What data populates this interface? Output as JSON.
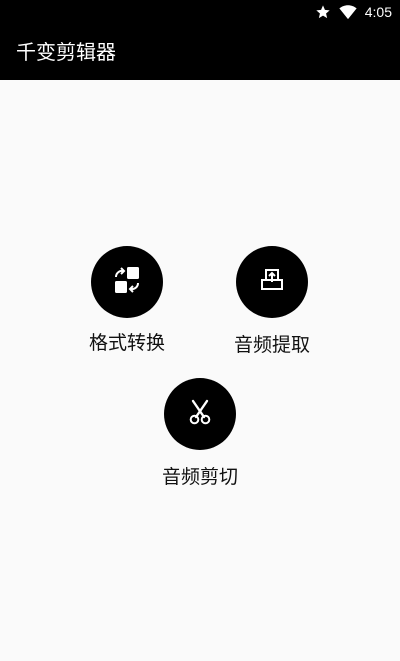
{
  "status_bar": {
    "time": "4:05",
    "icons": [
      "star-icon",
      "wifi-icon",
      "battery-icon"
    ]
  },
  "app_bar": {
    "title": "千变剪辑器"
  },
  "actions": [
    {
      "label": "格式转换",
      "icon": "convert-icon"
    },
    {
      "label": "音频提取",
      "icon": "extract-icon"
    },
    {
      "label": "音频剪切",
      "icon": "scissors-icon"
    }
  ],
  "colors": {
    "bar_background": "#000000",
    "content_background": "#fafafa",
    "circle": "#000000",
    "icon": "#ffffff",
    "label": "#111111"
  }
}
